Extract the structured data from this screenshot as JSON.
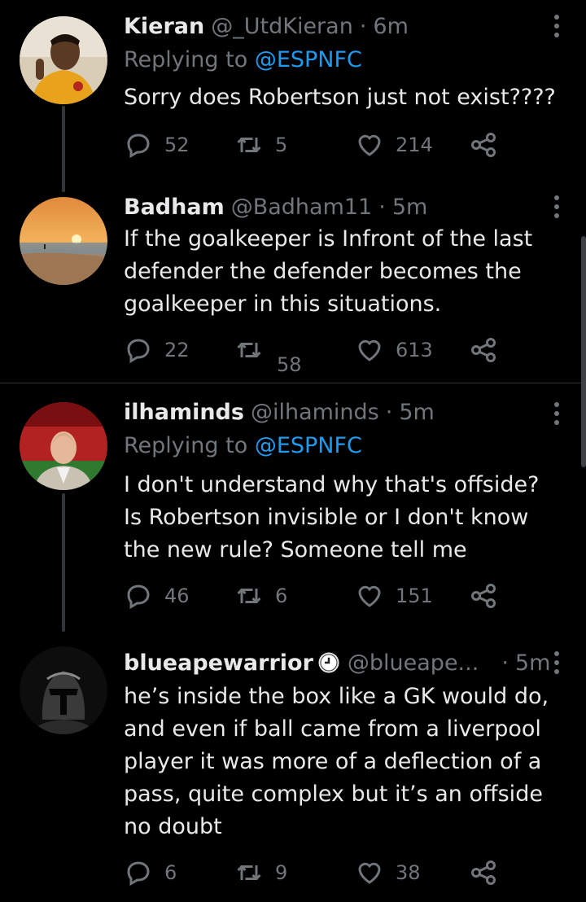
{
  "tweets": [
    {
      "name": "Kieran",
      "handle": "@_UtdKieran",
      "dot": "·",
      "time": "6m",
      "replying_prefix": "Replying to",
      "replying_to": "@ESPNFC",
      "text": "Sorry does Robertson just not exist????",
      "replies": "52",
      "retweets": "5",
      "likes": "214"
    },
    {
      "name": "Badham",
      "handle": "@Badham11",
      "dot": "·",
      "time": "5m",
      "text": "If the goalkeeper is Infront of the last defender the defender becomes the goalkeeper in this situations.",
      "replies": "22",
      "retweets": "58",
      "likes": "613"
    },
    {
      "name": "ilhaminds",
      "handle": "@ilhaminds",
      "dot": "·",
      "time": "5m",
      "replying_prefix": "Replying to",
      "replying_to": "@ESPNFC",
      "text": "I don't understand why that's offside? Is Robertson invisible or I don't know the new rule? Someone tell me",
      "replies": "46",
      "retweets": "6",
      "likes": "151"
    },
    {
      "name": "blueapewarrior",
      "handle": "@blueape...",
      "dot": "·",
      "time": "5m",
      "text": "he’s inside the box like a GK would do, and even if ball came from a liverpool player it was more of a deflection of a pass, quite complex but it’s an offside no doubt",
      "replies": "6",
      "retweets": "9",
      "likes": "38"
    }
  ],
  "icons": {
    "reply": "reply-icon",
    "retweet": "retweet-icon",
    "like": "heart-icon",
    "share": "share-icon",
    "more": "more-icon",
    "badge": "clock-badge-icon"
  },
  "colors": {
    "background": "#000000",
    "text": "#e7e9ea",
    "muted": "#71767b",
    "link": "#1d9bf0",
    "divider": "#2f3336"
  }
}
